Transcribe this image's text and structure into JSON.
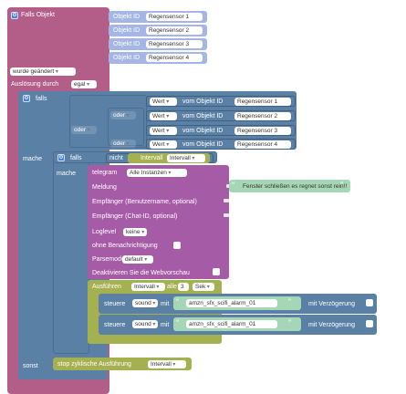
{
  "falls_objekt": {
    "title": "Falls Objekt",
    "objekt_id_label": "Objekt ID",
    "sensors": [
      "Regensensor 1",
      "Regensensor 2",
      "Regensensor 3",
      "Regensensor 4"
    ],
    "trigger_value": "wurde geändert",
    "ausloesung_label": "Auslösung durch",
    "ausloesung_value": "egal"
  },
  "if_block": {
    "falls_label": "falls",
    "mache_label": "mache",
    "sonst_label": "sonst",
    "oder_label": "oder",
    "wert_label": "Wert",
    "vom_objekt_label": "vom Objekt ID",
    "conditions": [
      "Regensensor 1",
      "Regensensor 2",
      "Regensensor 3",
      "Regensensor 4"
    ]
  },
  "inner_if": {
    "falls_label": "falls",
    "nicht_label": "nicht",
    "intervall_label": "Intervall",
    "intervall_var": "Intervall",
    "mache_label": "mache"
  },
  "telegram": {
    "title": "telegram",
    "instances": "Alle Instanzen",
    "meldung_label": "Meldung",
    "meldung_text": "Fenster schließen es regnet sonst rein!!",
    "empfaenger_benutzer": "Empfänger (Benutzername, optional)",
    "empfaenger_chat": "Empfänger (Chat-ID, optional)",
    "loglevel_label": "Loglevel",
    "loglevel_value": "keine",
    "ohne_benachrichtigung": "ohne Benachrichtigung",
    "parsemode_label": "Parsemode",
    "parsemode_value": "default",
    "webvorschau": "Deaktivieren Sie die Webvorschau"
  },
  "interval": {
    "ausfuehren_label": "Ausführen",
    "var": "Intervall",
    "alle_label": "alle",
    "count": "3",
    "unit": "Sek"
  },
  "steuere": [
    {
      "label": "steuere",
      "target": "sound",
      "mit": "mit",
      "value": "amzn_sfx_scifi_alarm_01",
      "delay": "mit Verzögerung"
    },
    {
      "label": "steuere",
      "target": "sound",
      "mit": "mit",
      "value": "amzn_sfx_scifi_alarm_01",
      "delay": "mit Verzögerung"
    }
  ],
  "else_action": {
    "label": "stop zyklische Ausführung",
    "var": "Intervall"
  },
  "colors": {
    "trigger": "#b35d89",
    "logic": "#5b80a5",
    "telegram": "#a55ba5",
    "timer": "#a5b150",
    "sound": "#5b80a5",
    "text": "#a5d6b6"
  }
}
